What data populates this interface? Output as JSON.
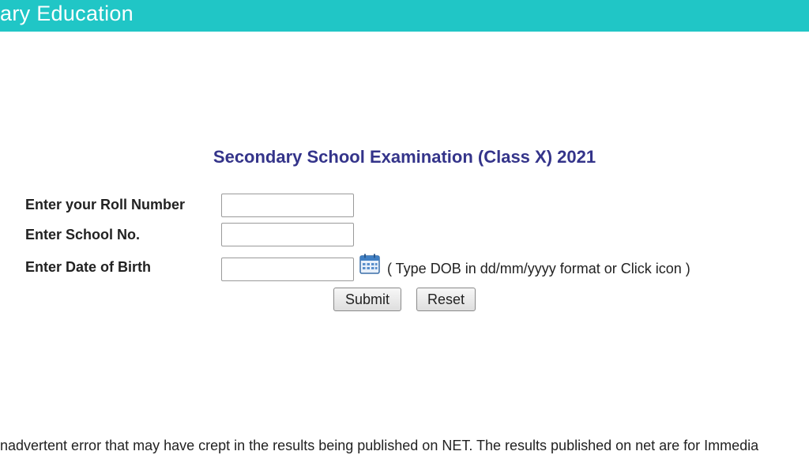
{
  "banner": {
    "title": "ary Education",
    "color": "#20c6c6"
  },
  "heading": {
    "text": "Secondary School Examination (Class X) 2021",
    "color": "#34348a"
  },
  "form": {
    "roll_label": "Enter your Roll Number",
    "roll_value": "",
    "school_label": "Enter School No.",
    "school_value": "",
    "dob_label": "Enter Date of Birth",
    "dob_value": "",
    "dob_hint": "( Type DOB in dd/mm/yyyy format or Click icon )",
    "calendar_icon": "calendar-icon",
    "submit_label": "Submit",
    "reset_label": "Reset"
  },
  "footer": {
    "notice": "inadvertent error that may have crept in the results being published on NET. The results published on net are for Immedia"
  }
}
